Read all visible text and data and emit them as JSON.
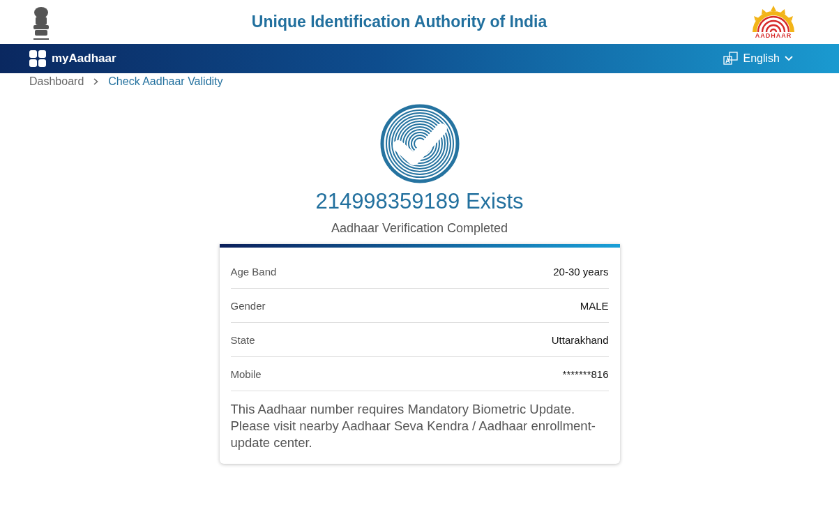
{
  "header": {
    "title": "Unique Identification Authority of India",
    "logo_text": "AADHAAR"
  },
  "navbar": {
    "app_name": "myAadhaar",
    "language": "English"
  },
  "breadcrumb": [
    {
      "label": "Dashboard",
      "kind": "link"
    },
    {
      "label": "Check Aadhaar Validity",
      "kind": "current"
    }
  ],
  "result": {
    "heading": "214998359189 Exists",
    "subheading": "Aadhaar Verification Completed"
  },
  "details": [
    {
      "label": "Age Band",
      "value": "20-30 years"
    },
    {
      "label": "Gender",
      "value": "MALE"
    },
    {
      "label": "State",
      "value": "Uttarakhand"
    },
    {
      "label": "Mobile",
      "value": "*******816"
    }
  ],
  "notice": "This Aadhaar number requires Mandatory Biometric Update. Please visit nearby Aadhaar Seva Kendra / Aadhaar enrollment-update center."
}
